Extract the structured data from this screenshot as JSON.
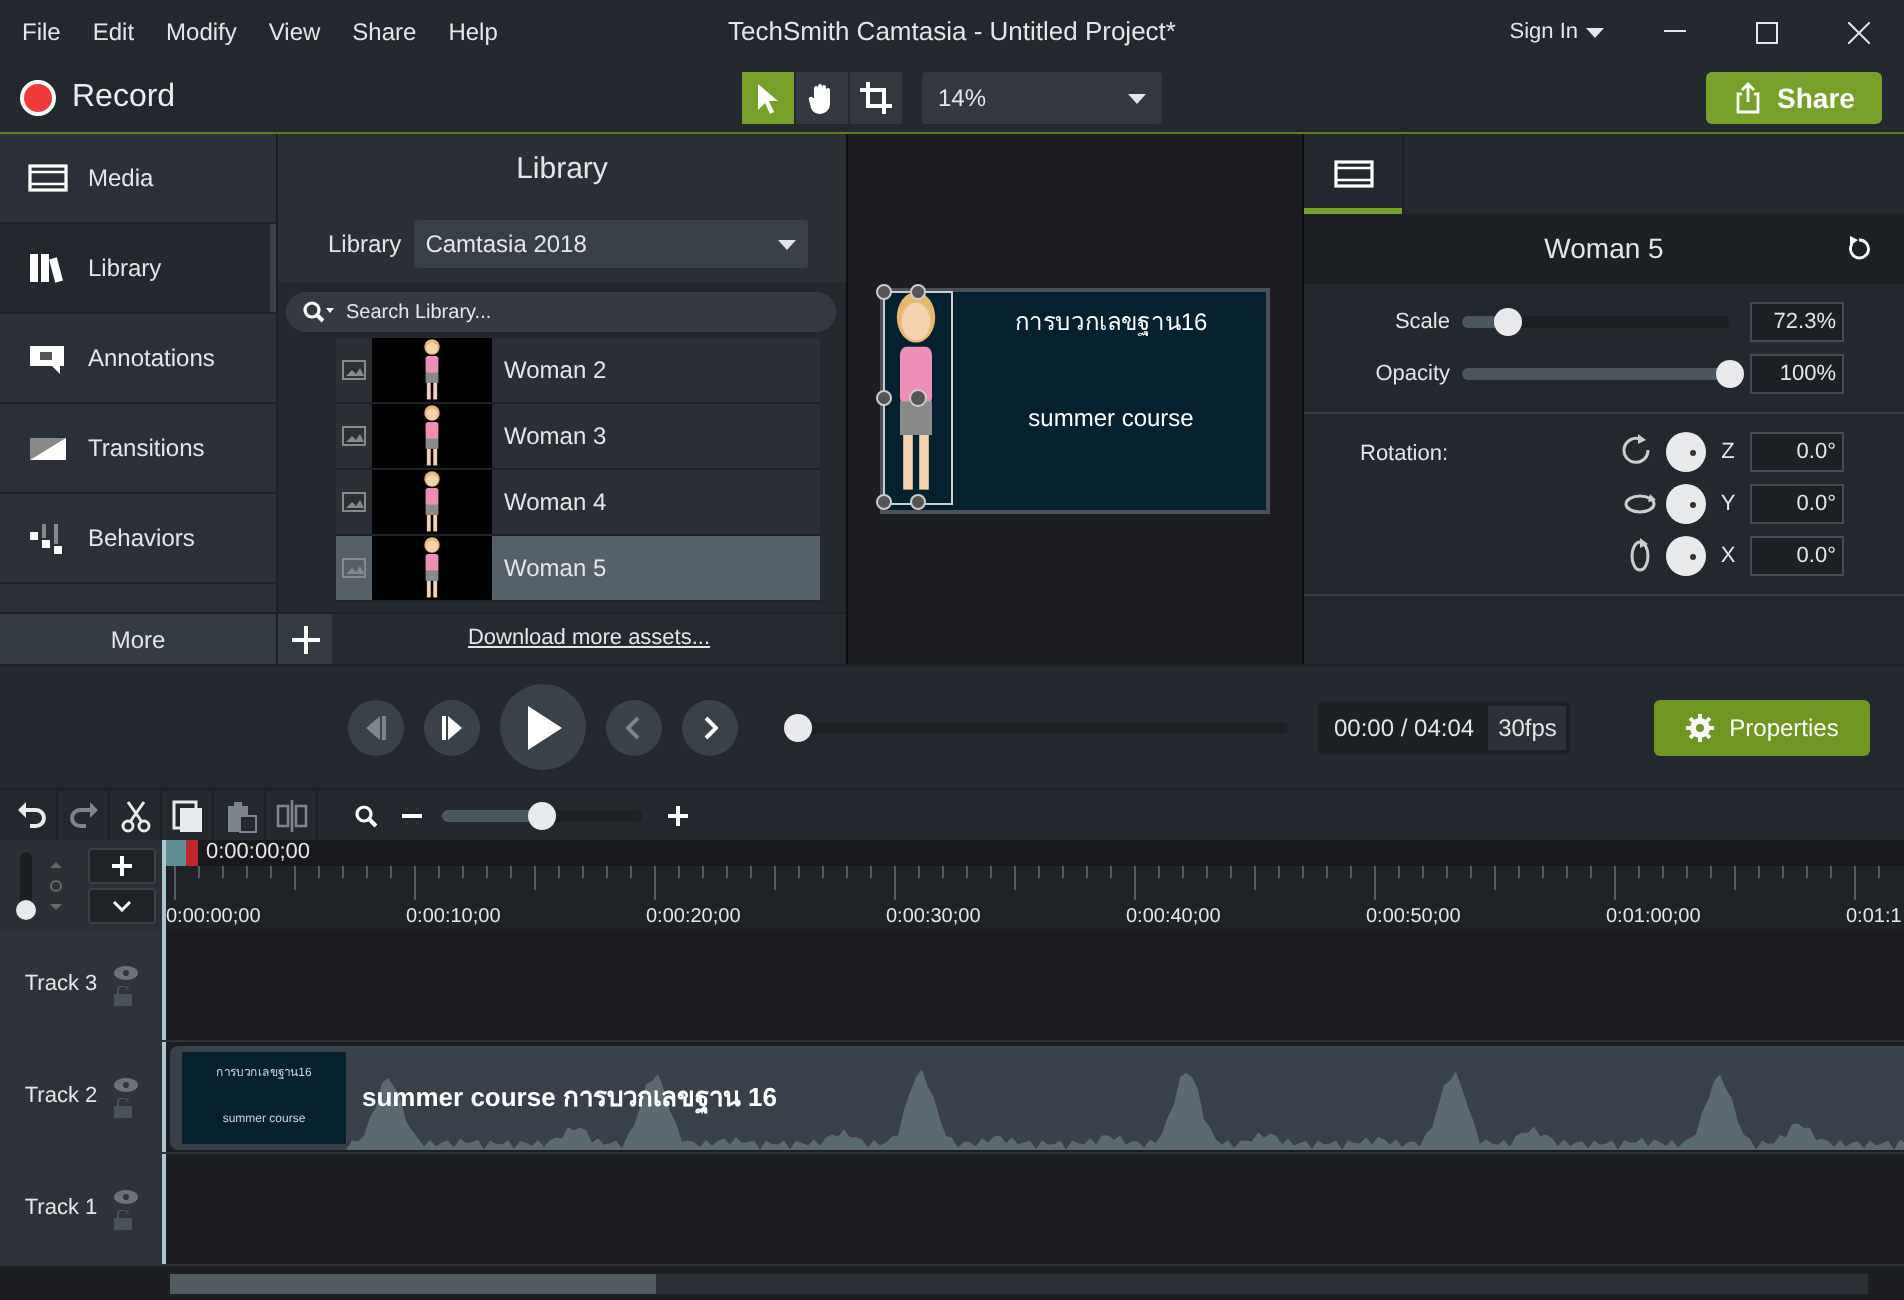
{
  "window": {
    "menu": [
      "File",
      "Edit",
      "Modify",
      "View",
      "Share",
      "Help"
    ],
    "title": "TechSmith Camtasia - Untitled Project*",
    "sign_in": "Sign In"
  },
  "toolbar": {
    "record": "Record",
    "tools": [
      {
        "kind": "pointer",
        "selected": true
      },
      {
        "kind": "hand",
        "selected": false
      },
      {
        "kind": "crop",
        "selected": false
      }
    ],
    "zoom": "14%",
    "share": "Share"
  },
  "sidebar": {
    "items": [
      {
        "label": "Media",
        "kind": "media",
        "selected": false
      },
      {
        "label": "Library",
        "kind": "library",
        "selected": true
      },
      {
        "label": "Annotations",
        "kind": "annotations",
        "selected": false
      },
      {
        "label": "Transitions",
        "kind": "transitions",
        "selected": false
      },
      {
        "label": "Behaviors",
        "kind": "behaviors",
        "selected": false
      }
    ],
    "more": "More"
  },
  "library": {
    "title": "Library",
    "library_label": "Library",
    "library_value": "Camtasia 2018",
    "search": {
      "placeholder": "Search Library..."
    },
    "items": [
      {
        "label": "Woman 2",
        "selected": false
      },
      {
        "label": "Woman 3",
        "selected": false
      },
      {
        "label": "Woman 4",
        "selected": false
      },
      {
        "label": "Woman 5",
        "selected": true
      }
    ],
    "download_link": "Download more assets..."
  },
  "canvas": {
    "slide_title": "การบวกเลขฐาน16",
    "slide_subtitle": "summer course"
  },
  "properties": {
    "tabs": [
      {
        "selected": true
      }
    ],
    "heading": "Woman 5",
    "sliders": [
      {
        "label": "Scale",
        "level": 0.17,
        "reading": "72.3%"
      },
      {
        "label": "Opacity",
        "level": 1,
        "reading": "100%"
      }
    ],
    "rotation_label": "Rotation:",
    "rotation": [
      {
        "kind": "z",
        "axis": "Z",
        "value": "0.0°"
      },
      {
        "kind": "y",
        "axis": "Y",
        "value": "0.0°"
      },
      {
        "kind": "x",
        "axis": "X",
        "value": "0.0°"
      }
    ]
  },
  "playback": {
    "level": 0,
    "time": "00:00 / 04:04",
    "fps": "30fps",
    "properties_button": "Properties"
  },
  "timeline_toolbar": {
    "tools": [
      {
        "kind": "undo",
        "disabled": false
      },
      {
        "kind": "redo",
        "disabled": true
      },
      {
        "kind": "cut",
        "disabled": false
      },
      {
        "kind": "copy",
        "disabled": false
      },
      {
        "kind": "paste",
        "disabled": true
      },
      {
        "kind": "split",
        "disabled": true
      }
    ],
    "zoom": {
      "level": 0.5
    }
  },
  "timeline": {
    "track_height": {
      "level": 0
    },
    "playhead_time": "0:00:00;00",
    "ruler_labels": [
      "0:00:00;00",
      "0:00:10;00",
      "0:00:20;00",
      "0:00:30;00",
      "0:00:40;00",
      "0:00:50;00",
      "0:01:00;00",
      "0:01:1"
    ],
    "tracks": [
      {
        "name": "Track 3"
      },
      {
        "name": "Track 2",
        "clip": {
          "title": "summer course การบวกเลขฐาน 16",
          "thumb_title": "การบวกเลขฐาน16",
          "thumb_subtitle": "summer course"
        }
      },
      {
        "name": "Track 1"
      }
    ]
  }
}
